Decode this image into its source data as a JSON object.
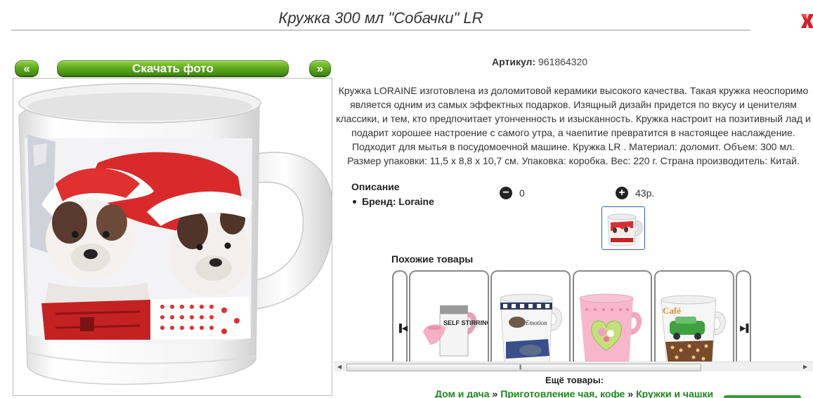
{
  "product": {
    "title": "Кружка 300 мл \"Собачки\" LR",
    "article_label": "Артикул:",
    "article_value": "961864320",
    "description": "Кружка LORAINE изготовлена из доломитовой керамики высокого качества. Такая кружка неоспоримо является одним из самых эффектных подарков. Изящный дизайн придется по вкусу и ценителям классики, и тем, кто предпочитает утонченность и изысканность. Кружка настроит на позитивный лад и подарит хорошее настроение с самого утра, а чаепитие превратится в настоящее наслаждение. Подходит для мытья в посудомоечной машине. Кружка LR . Материал: доломит. Объем: 300 мл. Размер упаковки: 11,5 х 8,8 х 10,7 см. Упаковка: коробка. Вес: 220 г. Страна производитель: Китай.",
    "specs_heading": "Описание",
    "brand": "Бренд: Loraine"
  },
  "photo_nav": {
    "prev": "«",
    "download": "Скачать фото",
    "next": "»"
  },
  "cart": {
    "minus_symbol": "−",
    "quantity": "0",
    "plus_symbol": "+",
    "price": "43р."
  },
  "similar": {
    "heading": "Похожие товары",
    "items": [
      {
        "label": "SELF STIRRING MUG",
        "colors": [
          "#e8a0b8",
          "#222222"
        ]
      },
      {
        "label": "Emotion",
        "colors": [
          "#3a4e8c",
          "#888888"
        ]
      },
      {
        "label": "",
        "colors": [
          "#f2a0c0",
          "#8bc34a"
        ]
      },
      {
        "label": "Café",
        "colors": [
          "#6a4b2a",
          "#3fa13f"
        ]
      }
    ]
  },
  "more": {
    "label": "Ещё товары:",
    "crumbs": [
      "Дом и дача",
      "Приготовление чая, кофе",
      "Кружки и чашки"
    ],
    "separator": "»"
  },
  "colors": {
    "accent_green": "#5aa51d",
    "link_green": "#1a8a1a",
    "close_red": "#d0202a"
  },
  "icons": [
    "close-icon",
    "minus-circle-icon",
    "plus-circle-icon",
    "scroll-left-icon",
    "scroll-right-icon"
  ]
}
